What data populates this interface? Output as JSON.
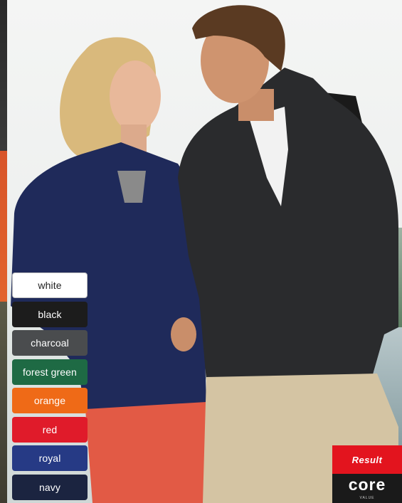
{
  "swatches": [
    {
      "label": "white",
      "color": "#ffffff",
      "light": true
    },
    {
      "label": "black",
      "color": "#1c1c1c"
    },
    {
      "label": "charcoal",
      "color": "#4a4c4e"
    },
    {
      "label": "forest green",
      "color": "#1e6a44"
    },
    {
      "label": "orange",
      "color": "#ef6a17"
    },
    {
      "label": "red",
      "color": "#e01b2a"
    },
    {
      "label": "royal",
      "color": "#263a85"
    },
    {
      "label": "navy",
      "color": "#1b2440"
    }
  ],
  "logo": {
    "top_text": "Result",
    "core_text": "core",
    "value_text": "VALUE"
  },
  "photo": {
    "woman_jacket_color": "#1f2a5a",
    "man_jacket_color": "#2a2b2d"
  }
}
